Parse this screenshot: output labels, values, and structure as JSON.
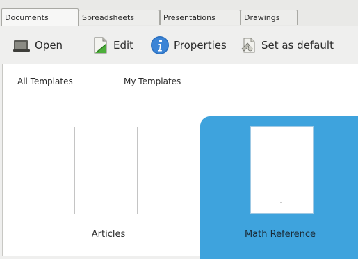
{
  "tabs": [
    {
      "label": "Documents",
      "active": true
    },
    {
      "label": "Spreadsheets",
      "active": false
    },
    {
      "label": "Presentations",
      "active": false
    },
    {
      "label": "Drawings",
      "active": false
    }
  ],
  "toolbar": {
    "open_label": "Open",
    "edit_label": "Edit",
    "properties_label": "Properties",
    "set_default_label": "Set as default"
  },
  "filters": {
    "all_templates": "All Templates",
    "my_templates": "My Templates"
  },
  "templates": [
    {
      "name": "Articles",
      "selected": false
    },
    {
      "name": "Math Reference",
      "selected": true
    }
  ],
  "colors": {
    "selection": "#3ea3dd",
    "info_icon": "#2a6fbf"
  }
}
